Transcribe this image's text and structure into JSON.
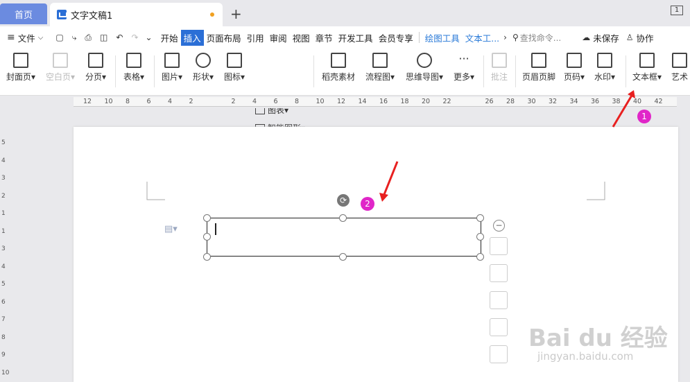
{
  "tabs": {
    "home": "首页",
    "doc": "文字文稿1",
    "plus": "+",
    "win": "1"
  },
  "menu": {
    "file": "文件",
    "items": [
      "开始",
      "插入",
      "页面布局",
      "引用",
      "审阅",
      "视图",
      "章节",
      "开发工具",
      "会员专享"
    ],
    "ctx": [
      "绘图工具",
      "文本工..."
    ],
    "search": "查找命令...",
    "unsaved": "未保存",
    "collab": "协作"
  },
  "ribbon": {
    "cover": "封面页",
    "blank": "空白页",
    "break": "分页",
    "table": "表格",
    "picture": "图片",
    "shape": "形状",
    "icon": "图标",
    "chart": "图表",
    "smart": "智能图形",
    "daoke": "稻壳素材",
    "flow": "流程图",
    "mind": "思维导图",
    "more": "更多",
    "comment": "批注",
    "header": "页眉页脚",
    "pagenum": "页码",
    "watermark": "水印",
    "textbox": "文本框",
    "art": "艺术"
  },
  "ruler": {
    "ticks": [
      "12",
      "10",
      "8",
      "6",
      "4",
      "2",
      "",
      "2",
      "4",
      "6",
      "8",
      "10",
      "12",
      "14",
      "16",
      "18",
      "20",
      "22",
      "",
      "26",
      "28",
      "30",
      "32",
      "34",
      "36",
      "38",
      "40",
      "42"
    ]
  },
  "vruler": [
    "5",
    "4",
    "3",
    "2",
    "1",
    "1",
    "3",
    "4",
    "5",
    "6",
    "7",
    "8",
    "9",
    "10"
  ],
  "annotations": {
    "b1": "1",
    "b2": "2"
  },
  "watermark": {
    "logo": "Bai du 经验",
    "url": "jingyan.baidu.com"
  },
  "colors": {
    "accent": "#2b6fd6",
    "badge": "#e026c8",
    "arrow": "#e82020"
  }
}
